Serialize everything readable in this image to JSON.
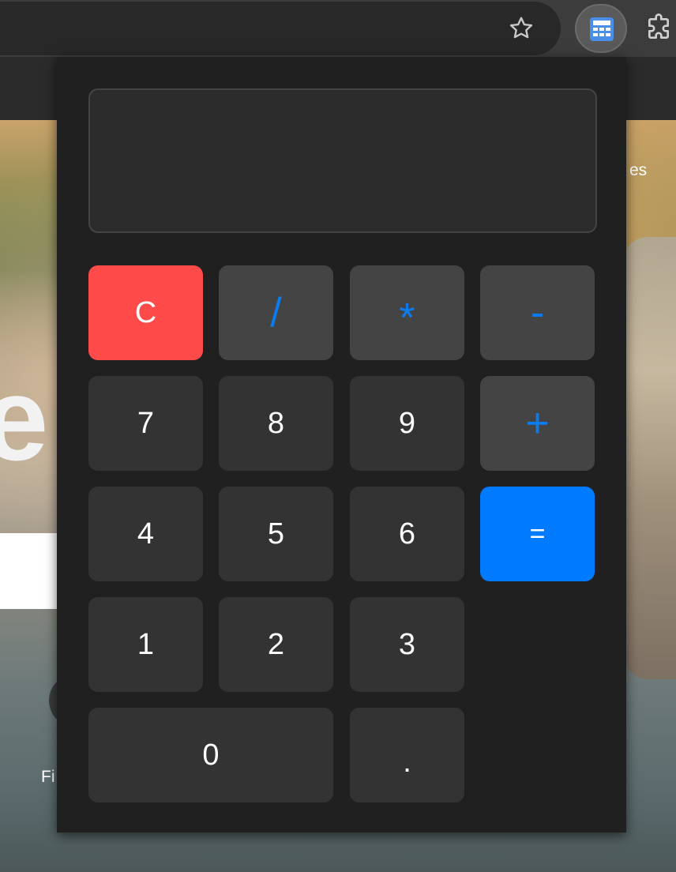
{
  "background_page": {
    "partial_letter": "e",
    "partial_side_text": "es",
    "partial_bottom_text": "Fi"
  },
  "browser": {
    "star_icon": "star-outline-icon",
    "active_extension_icon": "calculator-icon",
    "extensions_icon": "puzzle-icon"
  },
  "calculator": {
    "display_value": "",
    "keys": {
      "clear": "C",
      "divide": "/",
      "multiply": "*",
      "subtract": "-",
      "add": "+",
      "equals": "=",
      "seven": "7",
      "eight": "8",
      "nine": "9",
      "four": "4",
      "five": "5",
      "six": "6",
      "one": "1",
      "two": "2",
      "three": "3",
      "zero": "0",
      "decimal": "."
    },
    "colors": {
      "clear": "#ff4a4a",
      "operator_text": "#0a7cf0",
      "equals": "#007bff",
      "number_key": "#333333",
      "operator_key": "#444444"
    }
  }
}
